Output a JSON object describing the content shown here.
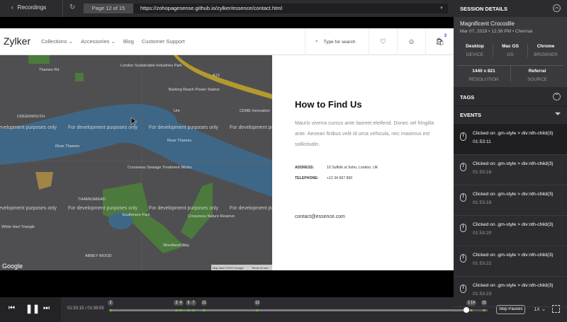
{
  "topbar": {
    "back_label": "Recordings",
    "page_indicator": "Page 12 of 15",
    "url": "https://zohopagesense.github.io/zylker/essence/contact.html"
  },
  "site": {
    "logo": "Zylker",
    "nav": [
      "Collections",
      "Accessories",
      "Blog",
      "Customer Support"
    ],
    "search_placeholder": "Type for search",
    "cart_count": "3"
  },
  "map": {
    "labels": [
      "London Sustainable Industries Park",
      "Thames Rd",
      "Barking Reach Power Station",
      "Um",
      "CEME Innovation",
      "CREEKMOUTH",
      "River Thames",
      "River Thames",
      "Crossness Sewage Treatment Works",
      "THAMESMEAD",
      "Southmere Park",
      "Crossness Nature Reserve",
      "White Hart Triangle",
      "Woodland Way",
      "ABBEY WOOD",
      "A13"
    ],
    "watermark": "For development purposes only",
    "logo": "Google",
    "attribution": "Map data ©2019 Google",
    "terms": "Terms of Use"
  },
  "contact": {
    "title": "How to Find Us",
    "body": "Mauris viverra cursus ante laoreet eleifend. Donec vel fringilla ante. Aenean finibus velit id urna vehicula, nec maximus est sollicitudin.",
    "address_label": "ADDRESS:",
    "address": "10 Suffolk st Soho, London, UK",
    "telephone_label": "TELEPHONE:",
    "telephone": "+12 34 567 890",
    "email": "contact@essence.com"
  },
  "player": {
    "current": "01:53:15",
    "total": "01:59:55",
    "markers": [
      "2",
      "3",
      "4",
      "5",
      "7",
      "11",
      "12",
      "1 14",
      "15"
    ],
    "skip_pauses": "Skip Pauses",
    "speed": "1x"
  },
  "session": {
    "header": "SESSION DETAILS",
    "name": "Magnificent Crocodile",
    "date": "Mar 07, 2019",
    "time": "12:38 PM",
    "location": "Chennai",
    "device": {
      "value": "Desktop",
      "label": "DEVICE"
    },
    "os": {
      "value": "Mac OS",
      "label": "OS"
    },
    "browser": {
      "value": "Chrome",
      "label": "BROWSER"
    },
    "resolution": {
      "value": "1440 x 821",
      "label": "RESOLUTION"
    },
    "source": {
      "value": "Referral",
      "label": "SOURCE"
    }
  },
  "tags": {
    "header": "TAGS"
  },
  "events": {
    "header": "EVENTS",
    "items": [
      {
        "text": "Clicked on .gm-style > div:nth-child(3)",
        "time": "01:53:11"
      },
      {
        "text": "Clicked on .gm-style > div:nth-child(3)",
        "time": "01:53:16"
      },
      {
        "text": "Clicked on .gm-style > div:nth-child(3)",
        "time": "01:53:18"
      },
      {
        "text": "Clicked on .gm-style > div:nth-child(3)",
        "time": "01:53:20"
      },
      {
        "text": "Clicked on .gm-style > div:nth-child(3)",
        "time": "01:53:22"
      },
      {
        "text": "Clicked on .gm-style > div:nth-child(3)",
        "time": "01:53:23"
      }
    ]
  }
}
